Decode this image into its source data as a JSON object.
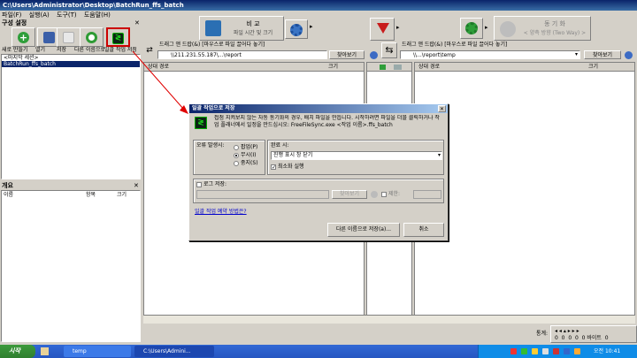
{
  "window": {
    "title": "C:\\Users\\Administrator\\Desktop\\BatchRun_ffs_batch"
  },
  "menu": {
    "items": [
      "파일(F)",
      "실행(A)",
      "도구(T)",
      "도움말(H)"
    ]
  },
  "config": {
    "title": "구성 설정",
    "toolbar_labels": [
      "새로 만들기",
      "열기",
      "저장",
      "다른 이름으로 저장",
      "일괄 작업 저장"
    ],
    "items": [
      "<마지막 세션>",
      "BatchRun_ffs_batch"
    ]
  },
  "overview": {
    "title": "개요",
    "columns": [
      "이름",
      "항목",
      "크기"
    ]
  },
  "compare": {
    "label": "비 교",
    "sublabel": "파일 시간 및 크기"
  },
  "sync": {
    "label": "동 기 화",
    "sublabel": "< 양측 방향 (Two Way) >"
  },
  "left_panel": {
    "drag_hint": "드래그 앤 드랍(&) [마우스로 파일 끌어다 놓기]",
    "path": "\\\\211.231.55.187\\...\\report",
    "browse": "찾아보기",
    "col_path": "상대 경로",
    "col_size": "크기"
  },
  "right_panel": {
    "drag_hint": "드래그 앤 드랍(&) [마우스로 파일 끌어다 놓기]",
    "path": "\\\\...\\report\\temp",
    "browse": "찾아보기",
    "col_path": "상대 경로",
    "col_size": "크기"
  },
  "dialog": {
    "title": "일괄 작업으로 저장",
    "description": "접점 지켜보지 않는 자동 동기화의 경우, 배치 파일을 만듭니다. 시작하려면 파일을 더블 클릭하거나 작업 플래너에서 일정을 만드십시오: FreeFileSync.exe <작업 이름>.ffs_batch",
    "error_label": "오류 발생시:",
    "error_options": [
      "팝업(P)",
      "무시(I)",
      "중지(S)"
    ],
    "error_selected": 1,
    "completion_label": "완료 시:",
    "completion_value": "진행 표시 창 닫기",
    "minimize_label": "최소화 실행",
    "minimize_checked": true,
    "log_label": "로그 저장:",
    "log_browse": "찾아보기",
    "limit_label": "제한:",
    "schedule_link": "일괄 작업 예약 방법은?",
    "save_as_button": "다른 이름으로 저장(a)...",
    "cancel_button": "취소"
  },
  "status": {
    "stats_label": "통계:",
    "counts": [
      "0",
      "0",
      "0",
      "0",
      "0",
      "0"
    ],
    "bytes_label": "0 바이트",
    "right_count": "0"
  },
  "taskbar": {
    "start": "시작",
    "tasks": [
      "temp",
      "C:\\Users\\Admini..."
    ],
    "clock": "오전 10:41"
  }
}
